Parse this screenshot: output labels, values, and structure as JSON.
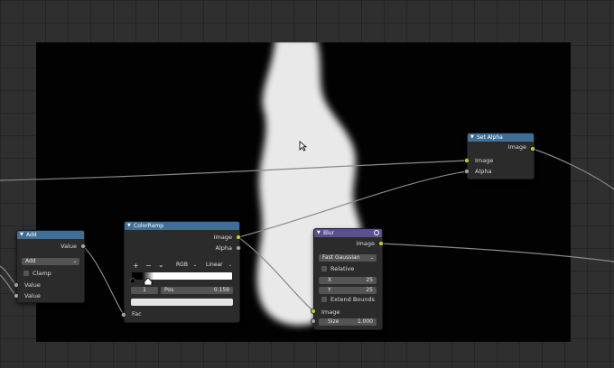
{
  "nodes": {
    "set_alpha": {
      "title": "Set Alpha",
      "out_image": "Image",
      "in_image": "Image",
      "in_alpha": "Alpha"
    },
    "add": {
      "title": "Add",
      "out_value": "Value",
      "operation": "Add",
      "clamp_label": "Clamp",
      "in_value_1": "Value",
      "in_value_2": "Value"
    },
    "colorramp": {
      "title": "ColorRamp",
      "out_image": "Image",
      "out_alpha": "Alpha",
      "add_symbol": "+",
      "remove_symbol": "−",
      "menu_symbol": "⌄",
      "color_mode": "RGB",
      "interpolation": "Linear",
      "stop_index": "1",
      "pos_label": "Pos",
      "pos_value": "0.159",
      "in_fac": "Fac",
      "ramp_stop_fraction": 0.159
    },
    "blur": {
      "title": "Blur",
      "out_image": "Image",
      "filter_type": "Fast Gaussian",
      "relative_label": "Relative",
      "x_label": "X",
      "x_value": "25",
      "y_label": "Y",
      "y_value": "25",
      "extend_bounds_label": "Extend Bounds",
      "in_image": "Image",
      "size_label": "Size",
      "size_value": "1.000"
    }
  },
  "icons": {
    "collapse": "collapse-triangle-icon",
    "globe": "globe-icon",
    "cursor": "mouse-cursor-icon"
  },
  "colors": {
    "socket_image": "#c7c729",
    "socket_value": "#a1a1a1",
    "header_converter": "#3f6f97",
    "header_filter": "#5a4f8f"
  }
}
